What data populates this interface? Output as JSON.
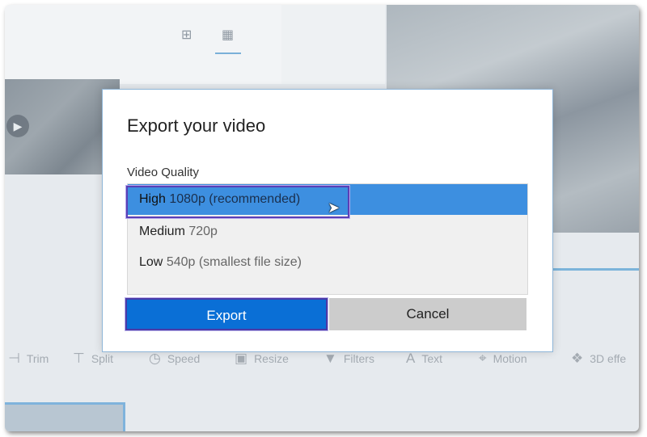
{
  "background_app": {
    "view_icons": [
      "grid-2x2-icon",
      "grid-3x3-icon"
    ],
    "toolbar": [
      {
        "label": "Trim",
        "icon": "trim-icon"
      },
      {
        "label": "Split",
        "icon": "split-icon"
      },
      {
        "label": "Speed",
        "icon": "speed-icon"
      },
      {
        "label": "Resize",
        "icon": "resize-icon"
      },
      {
        "label": "Filters",
        "icon": "filters-icon"
      },
      {
        "label": "Text",
        "icon": "text-icon"
      },
      {
        "label": "Motion",
        "icon": "motion-icon"
      },
      {
        "label": "3D effe",
        "icon": "3d-effects-icon"
      }
    ]
  },
  "dialog": {
    "title": "Export your video",
    "quality_label": "Video Quality",
    "options": [
      {
        "name": "High",
        "detail": "1080p (recommended)",
        "selected": true
      },
      {
        "name": "Medium",
        "detail": "720p",
        "selected": false
      },
      {
        "name": "Low",
        "detail": "540p (smallest file size)",
        "selected": false
      }
    ],
    "export_label": "Export",
    "cancel_label": "Cancel"
  },
  "colors": {
    "selection": "#3d8fe0",
    "primary_button": "#0a6fd6",
    "secondary_button": "#cccccc",
    "focus_ring": "#5a3fb6"
  }
}
